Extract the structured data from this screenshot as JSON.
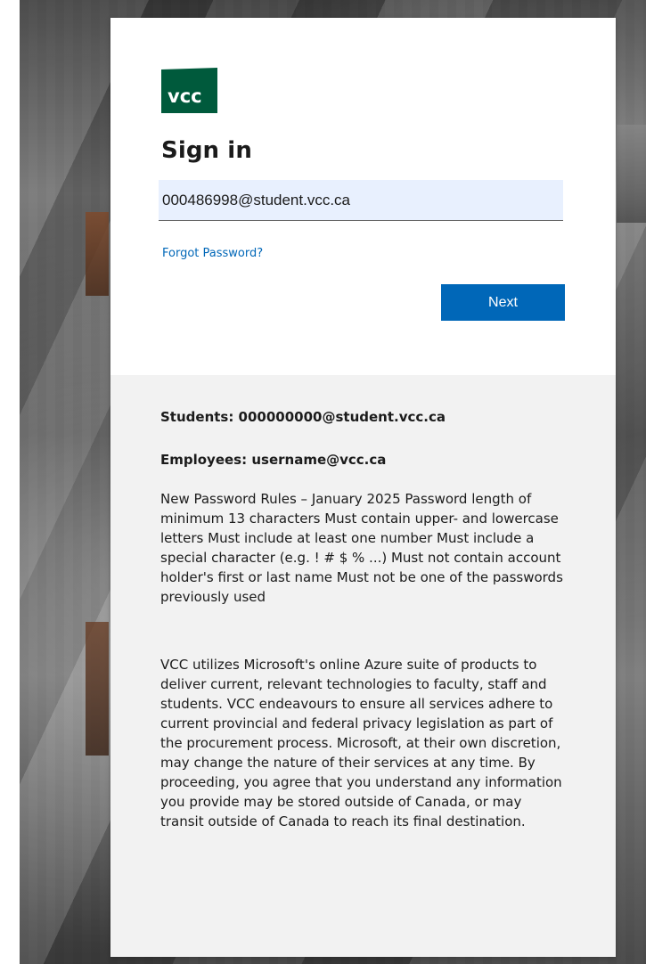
{
  "brand": {
    "logo_text": "vcc",
    "logo_color": "#005a3c"
  },
  "signin": {
    "title": "Sign in",
    "email_value": "000486998@student.vcc.ca",
    "forgot_password": "Forgot Password?",
    "next_label": "Next",
    "accent": "#0067b8"
  },
  "info": {
    "students": "Students: 000000000@student.vcc.ca",
    "employees": "Employees: username@vcc.ca",
    "rules": "New Password Rules – January 2025 Password length of minimum 13 characters Must contain upper- and lowercase letters Must include at least one number Must include a special character (e.g. ! # $ % ...) Must not contain account holder's first or last name Must not be one of the passwords previously used",
    "privacy": "VCC utilizes Microsoft's online Azure suite of products to deliver current, relevant technologies to faculty, staff and students. VCC endeavours to ensure all services adhere to current provincial and federal privacy legislation as part of the procurement process. Microsoft, at their own discretion, may change the nature of their services at any time. By proceeding, you agree that you understand any information you provide may be stored outside of Canada, or may transit outside of Canada to reach its final destination."
  }
}
